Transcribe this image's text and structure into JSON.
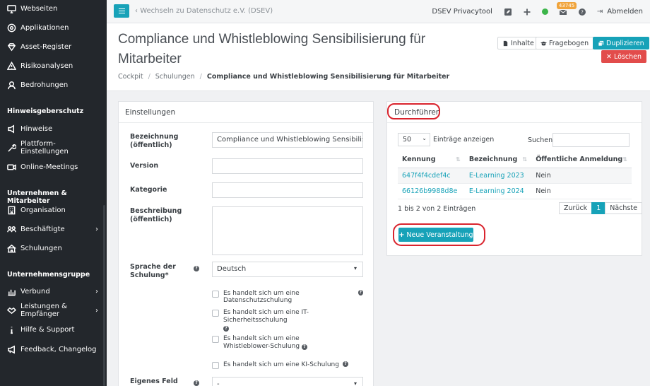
{
  "sidebar": {
    "items": [
      {
        "label": "Webseiten",
        "icon": "monitor-icon"
      },
      {
        "label": "Applikationen",
        "icon": "cog-circle-icon"
      },
      {
        "label": "Asset-Register",
        "icon": "diamond-icon"
      },
      {
        "label": "Risikoanalysen",
        "icon": "warning-icon"
      },
      {
        "label": "Bedrohungen",
        "icon": "user-icon"
      }
    ],
    "section_hinweis": "Hinweisgeberschutz",
    "hinweis_items": [
      {
        "label": "Hinweise",
        "icon": "megaphone-icon"
      },
      {
        "label": "Plattform-Einstellungen",
        "icon": "wrench-icon"
      },
      {
        "label": "Online-Meetings",
        "icon": "video-icon"
      }
    ],
    "section_unternehmen": "Unternehmen & Mitarbeiter",
    "unternehmen_items": [
      {
        "label": "Organisation",
        "icon": "building-icon"
      },
      {
        "label": "Beschäftigte",
        "icon": "users-icon"
      },
      {
        "label": "Schulungen",
        "icon": "school-icon"
      }
    ],
    "section_gruppe": "Unternehmensgruppe",
    "gruppe_items": [
      {
        "label": "Verbund",
        "icon": "chart-icon"
      },
      {
        "label": "Leistungen & Empfänger",
        "icon": "handshake-icon"
      },
      {
        "label": "Hilfe & Support",
        "icon": "info-icon"
      },
      {
        "label": "Feedback, Changelog",
        "icon": "bullhorn-icon"
      }
    ]
  },
  "topbar": {
    "switch_label": "Wechseln zu Datenschutz e.V. (DSEV)",
    "tool_name": "DSEV Privacytool",
    "badge": "43745",
    "logout": "Abmelden"
  },
  "header": {
    "title": "Compliance und Whistleblowing Sensibilisierung für Mitarbeiter",
    "breadcrumb": [
      "Cockpit",
      "Schulungen",
      "Compliance und Whistleblowing Sensibilisierung für Mitarbeiter"
    ],
    "btn_inhalte": "Inhalte",
    "btn_fragebogen": "Fragebogen",
    "btn_duplizieren": "Duplizieren",
    "btn_loeschen": "Löschen"
  },
  "settings": {
    "title": "Einstellungen",
    "bezeichnung_label": "Bezeichnung (öffentlich)",
    "bezeichnung_value": "Compliance und Whistleblowing Sensibilisierung",
    "version_label": "Version",
    "kategorie_label": "Kategorie",
    "beschreibung_label": "Beschreibung (öffentlich)",
    "sprache_label": "Sprache der Schulung*",
    "sprache_value": "Deutsch",
    "cb_datenschutz": "Es handelt sich um eine Datenschutzschulung",
    "cb_it": "Es handelt sich um eine IT-Sicherheitsschulung",
    "cb_whistle": "Es handelt sich um eine Whistleblower-Schulung",
    "cb_ki": "Es handelt sich um eine KI-Schulung",
    "eigenes_label": "Eigenes Feld",
    "eigenes_value": "-"
  },
  "durchfuehren": {
    "title": "Durchführen",
    "page_length": "50",
    "entries_label": "Einträge anzeigen",
    "search_label": "Suchen",
    "columns": [
      "Kennung",
      "Bezeichnung",
      "Öffentliche Anmeldung"
    ],
    "rows": [
      [
        "647f4f4cdef4c",
        "E-Learning 2023",
        "Nein"
      ],
      [
        "66126b9988d8e",
        "E-Learning 2024",
        "Nein"
      ]
    ],
    "info": "1 bis 2 von 2 Einträgen",
    "prev": "Zurück",
    "page": "1",
    "next": "Nächste",
    "add_button": "Neue Veranstaltung"
  },
  "colors": {
    "accent": "#17a2b8",
    "danger": "#e24c4b",
    "annotation": "#d9232d"
  }
}
